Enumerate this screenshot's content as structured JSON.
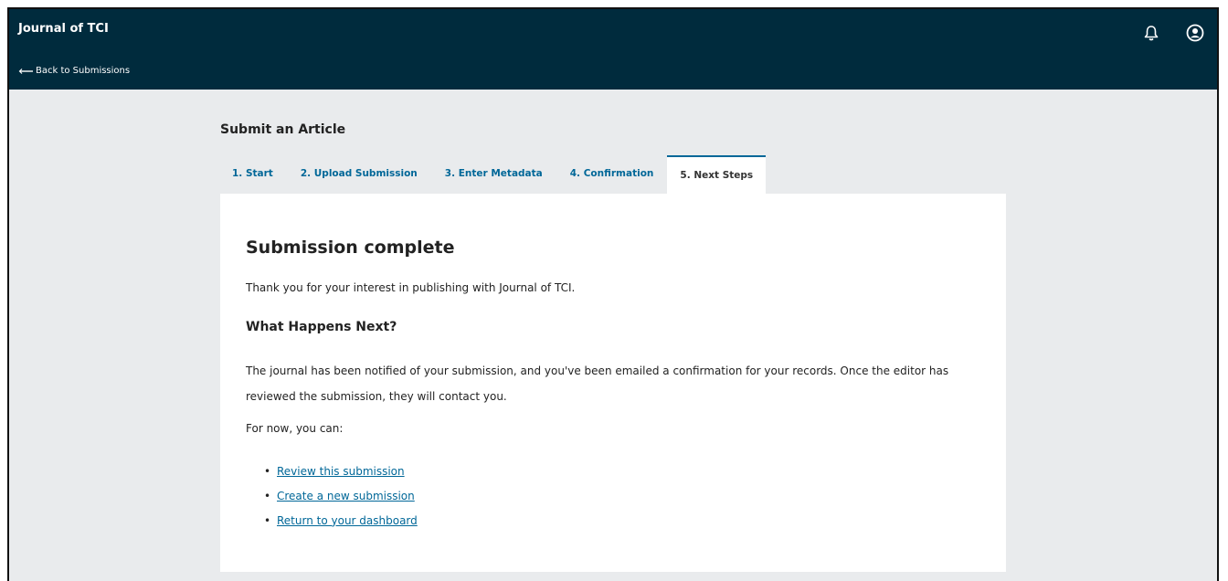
{
  "header": {
    "site_title": "Journal of TCI",
    "back_label": "Back to Submissions",
    "icons": [
      "bell-icon",
      "user-account-icon"
    ]
  },
  "page": {
    "heading": "Submit an Article"
  },
  "tabs": [
    {
      "label": "1. Start",
      "active": false
    },
    {
      "label": "2. Upload Submission",
      "active": false
    },
    {
      "label": "3. Enter Metadata",
      "active": false
    },
    {
      "label": "4. Confirmation",
      "active": false
    },
    {
      "label": "5. Next Steps",
      "active": true
    }
  ],
  "content": {
    "title": "Submission complete",
    "intro": "Thank you for your interest in publishing with Journal of TCI.",
    "subheading": "What Happens Next?",
    "body": "The journal has been notified of your submission, and you've been emailed a confirmation for your records. Once the editor has reviewed the submission, they will contact you.",
    "for_now": "For now, you can:",
    "links": [
      {
        "label": "Review this submission"
      },
      {
        "label": "Create a new submission"
      },
      {
        "label": "Return to your dashboard"
      }
    ]
  },
  "colors": {
    "header_bg": "#002b3d",
    "accent": "#006798",
    "page_bg": "#e9ebed"
  }
}
